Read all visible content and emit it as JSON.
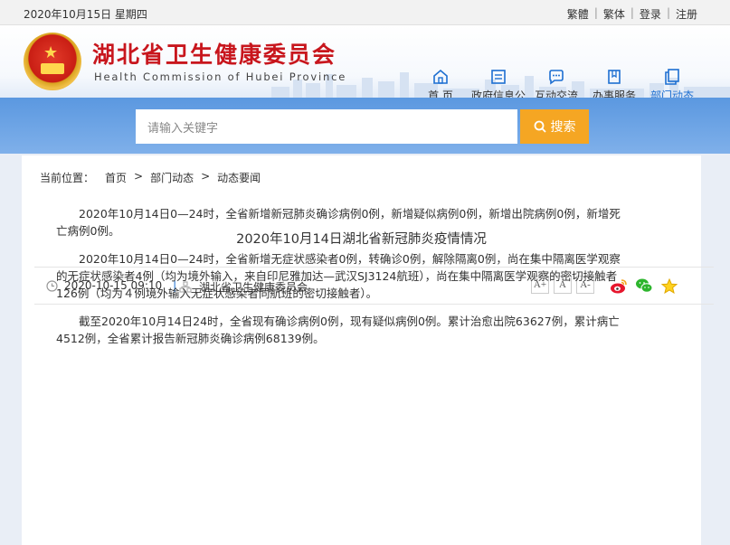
{
  "topbar": {
    "date": "2020年10月15日 星期四",
    "links": [
      "繁體",
      "繁体",
      "登录",
      "注册"
    ]
  },
  "header": {
    "title_cn": "湖北省卫生健康委员会",
    "title_en": "Health Commission of Hubei Province"
  },
  "nav": [
    {
      "label": "首 页",
      "icon": "home-icon"
    },
    {
      "label": "政府信息公开",
      "icon": "document-icon"
    },
    {
      "label": "互动交流",
      "icon": "chat-icon"
    },
    {
      "label": "办事服务",
      "icon": "bookmark-icon"
    },
    {
      "label": "部门动态",
      "icon": "copy-icon",
      "active": true
    }
  ],
  "search": {
    "placeholder": "请输入关键字",
    "button": "搜索"
  },
  "breadcrumb": {
    "label": "当前位置：",
    "items": [
      "首页",
      "部门动态",
      "动态要闻"
    ]
  },
  "article": {
    "title": "2020年10月14日湖北省新冠肺炎疫情情况",
    "datetime": "2020-10-15 09:10",
    "source": "湖北省卫生健康委员会",
    "font_sizes": [
      "A+",
      "A",
      "A-"
    ],
    "paragraphs": [
      "2020年10月14日0—24时，全省新增新冠肺炎确诊病例0例，新增疑似病例0例，新增出院病例0例，新增死亡病例0例。",
      "2020年10月14日0—24时，全省新增无症状感染者0例，转确诊0例，解除隔离0例，尚在集中隔离医学观察的无症状感染者4例（均为境外输入，来自印尼雅加达—武汉SJ3124航班），尚在集中隔离医学观察的密切接触者126例（均为４例境外输入无症状感染者同航班的密切接触者）。",
      "截至2020年10月14日24时，全省现有确诊病例0例，现有疑似病例0例。累计治愈出院63627例，累计病亡4512例，全省累计报告新冠肺炎确诊病例68139例。"
    ]
  },
  "colors": {
    "brand_red": "#c8161d",
    "nav_active": "#1d6fd1",
    "search_button": "#f5a623",
    "search_band": "#6aa2e4"
  }
}
